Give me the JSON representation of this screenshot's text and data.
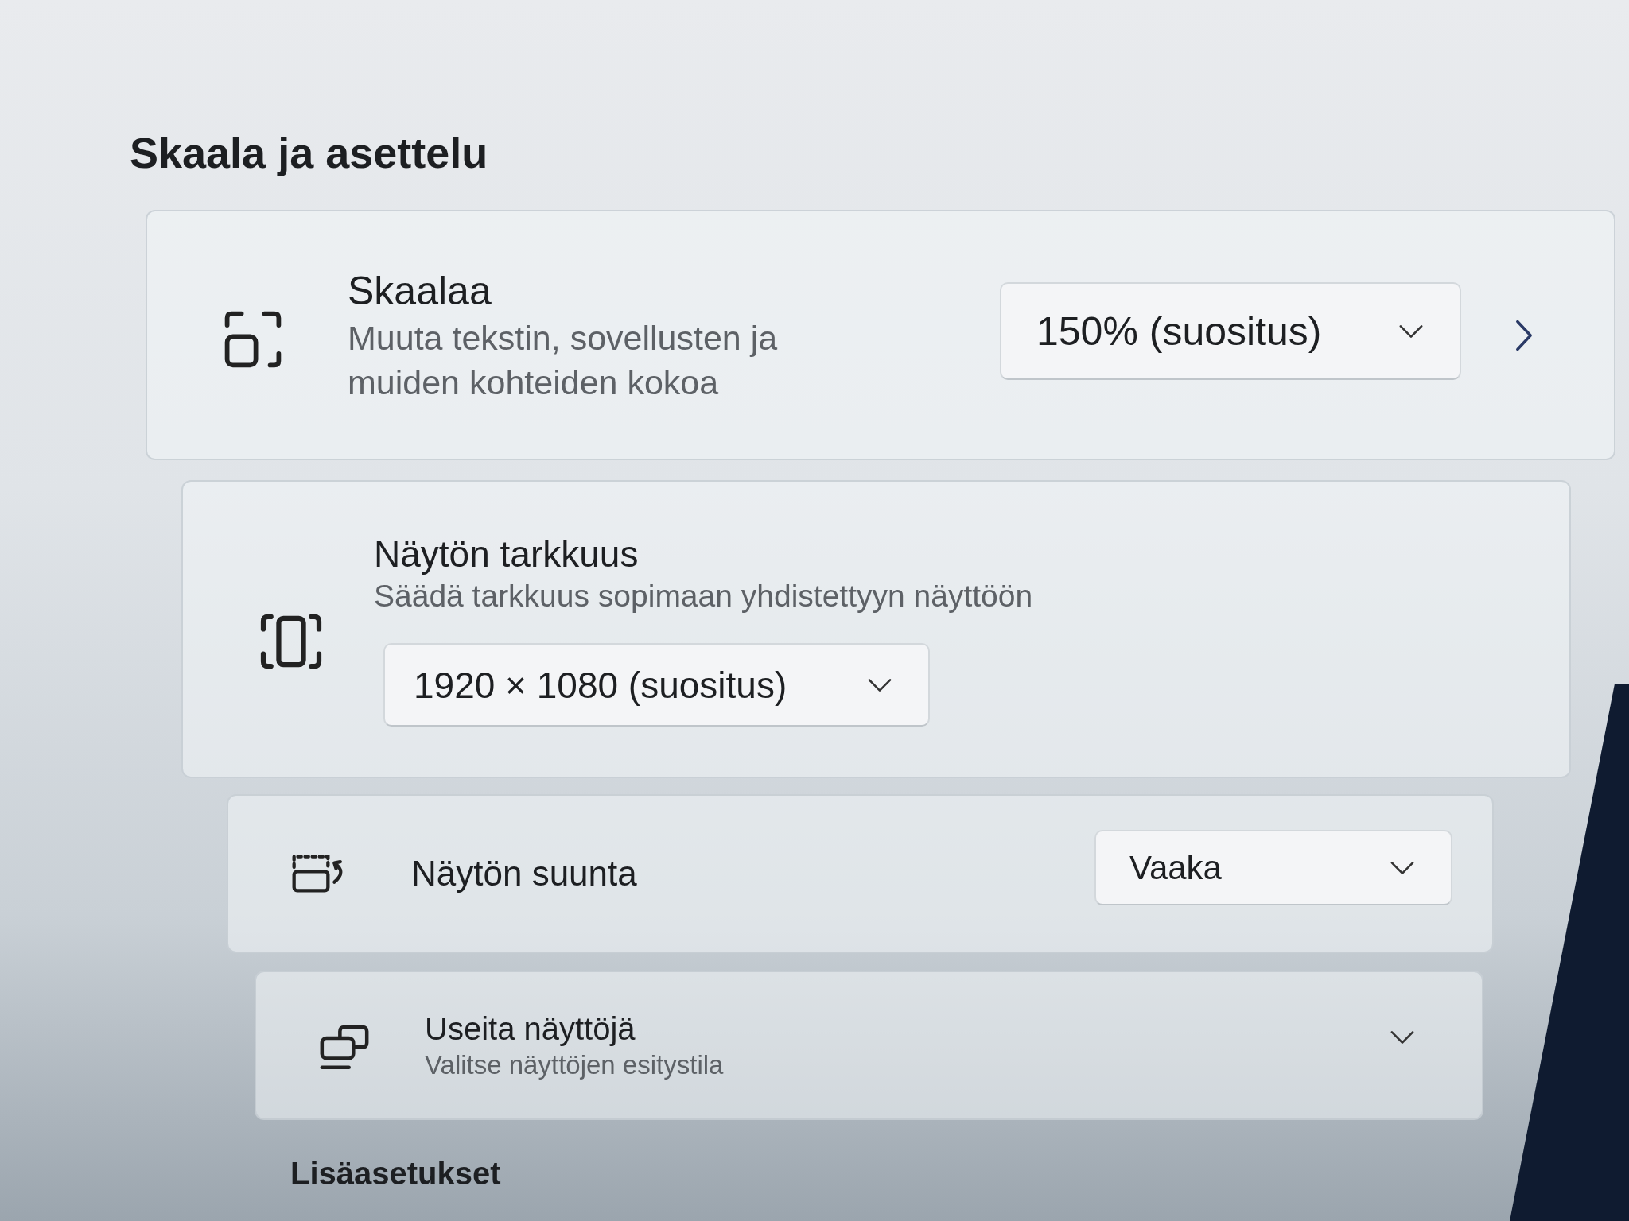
{
  "section": {
    "title": "Skaala ja asettelu"
  },
  "settings": [
    {
      "kind": "dropdown-link",
      "title": "Skaalaa",
      "description": "Muuta tekstin, sovellusten ja muiden kohteiden kokoa",
      "value": "150% (suositus)"
    },
    {
      "kind": "dropdown-below",
      "title": "Näytön tarkkuus",
      "description": "Säädä tarkkuus sopimaan yhdistettyyn näyttöön",
      "value": "1920 × 1080 (suositus)"
    },
    {
      "kind": "dropdown",
      "title": "Näytön suunta",
      "value": "Vaaka"
    },
    {
      "kind": "expander",
      "title": "Useita näyttöjä",
      "description": "Valitse näyttöjen esitystila",
      "expanded": false
    }
  ],
  "next_section": {
    "title": "Lisäasetukset"
  }
}
